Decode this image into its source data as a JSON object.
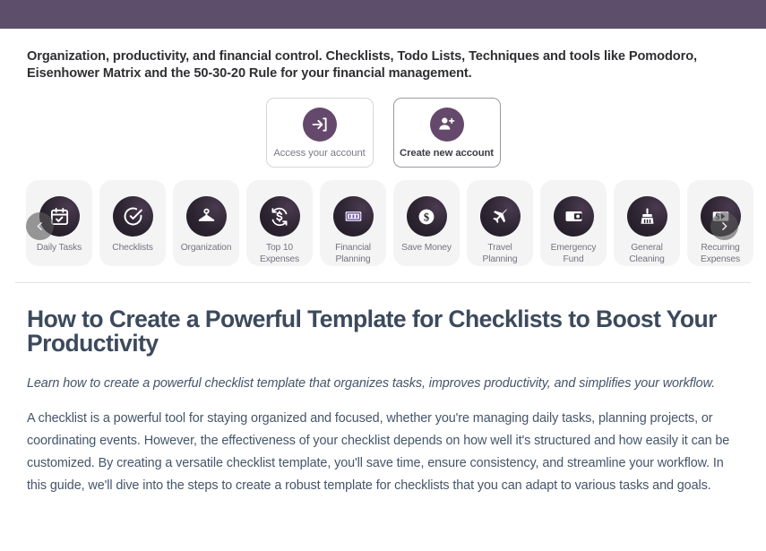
{
  "theme": {
    "header_bar_color": "#5d4e6b",
    "accent_purple": "#65496c",
    "card_bg": "#f4f4f5",
    "icon_circle_dark": "#2c2430",
    "text_body": "#44556a",
    "title_color": "#3c4a5c",
    "divider_color": "#e2e2e4"
  },
  "tagline": "Organization, productivity, and financial control. Checklists, Todo Lists, Techniques and tools like Pomodoro, Eisenhower Matrix and the 50-30-20 Rule for your financial management.",
  "account": {
    "login": {
      "label": "Access your account",
      "icon": "sign-in-icon"
    },
    "register": {
      "label": "Create new account",
      "icon": "user-plus-icon"
    }
  },
  "carousel": {
    "prev_label": "‹",
    "next_label": "›",
    "prev_icon": "chevron-left-icon",
    "next_icon": "chevron-right-icon",
    "items": [
      {
        "label": "Daily Tasks",
        "icon": "calendar-check-icon"
      },
      {
        "label": "Checklists",
        "icon": "check-circle-icon"
      },
      {
        "label": "Organization",
        "icon": "clothes-hanger-icon"
      },
      {
        "label": "Top 10\nExpenses",
        "icon": "money-refresh-icon"
      },
      {
        "label": "Financial\nPlanning",
        "icon": "banknote-icon"
      },
      {
        "label": "Save Money",
        "icon": "dollar-coin-icon"
      },
      {
        "label": "Travel\nPlanning",
        "icon": "airplane-icon"
      },
      {
        "label": "Emergency\nFund",
        "icon": "wallet-icon"
      },
      {
        "label": "General\nCleaning",
        "icon": "broom-icon"
      },
      {
        "label": "Recurring\nExpenses",
        "icon": "money-arrow-icon"
      }
    ]
  },
  "article": {
    "title": "How to Create a Powerful Template for Checklists to Boost Your Productivity",
    "subtitle": "Learn how to create a powerful checklist template that organizes tasks, improves productivity, and simplifies your workflow.",
    "body": "A checklist is a powerful tool for staying organized and focused, whether you're managing daily tasks, planning projects, or coordinating events. However, the effectiveness of your checklist depends on how well it's structured and how easily it can be customized. By creating a versatile checklist template, you'll save time, ensure consistency, and streamline your workflow. In this guide, we'll dive into the steps to create a robust template for checklists that you can adapt to various tasks and goals."
  }
}
